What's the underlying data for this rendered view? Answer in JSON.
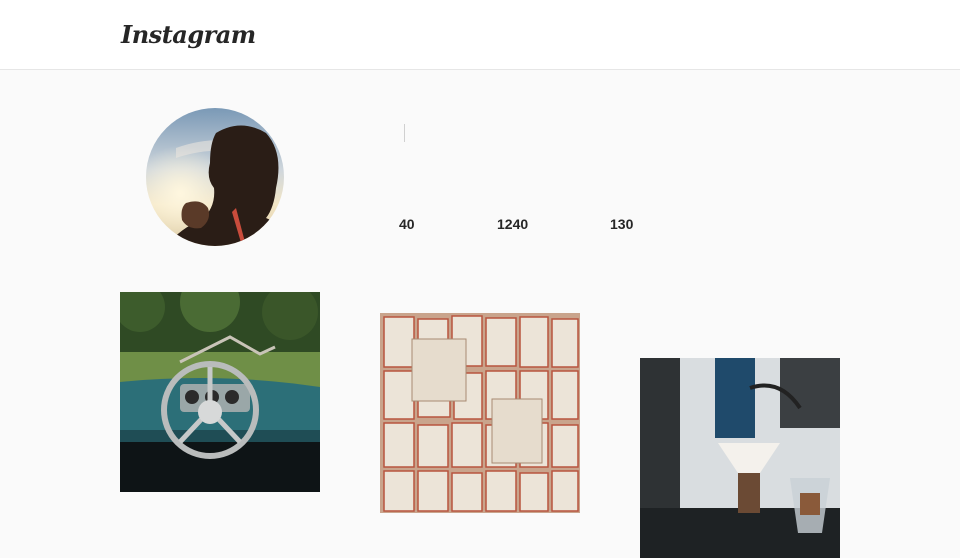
{
  "header": {
    "logo_text": "Instagram"
  },
  "profile": {
    "avatar_alt": "profile photo",
    "stats": {
      "posts": "40",
      "followers": "1240",
      "following": "130"
    }
  },
  "posts": [
    {
      "alt": "car steering wheel in field"
    },
    {
      "alt": "open books wall"
    },
    {
      "alt": "coffee pour over station"
    }
  ]
}
